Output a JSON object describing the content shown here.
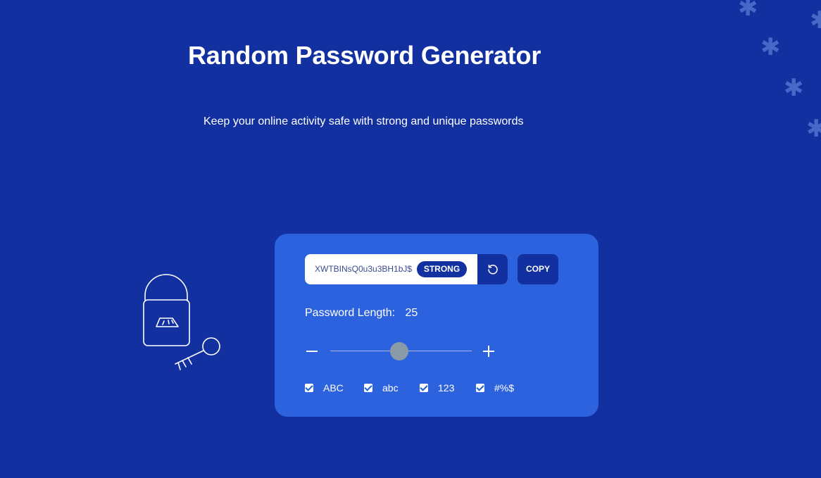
{
  "header": {
    "title": "Random Password Generator",
    "subtitle": "Keep your online activity safe with strong and unique passwords"
  },
  "generator": {
    "password": "XWTBINsQ0u3u3BH1bJ$",
    "strength": "STRONG",
    "copy_label": "COPY",
    "refresh_icon": "refresh-icon",
    "length_label": "Password Length:",
    "length_value": "25",
    "length_fraction": 0.49,
    "options": [
      {
        "label": "ABC",
        "checked": true
      },
      {
        "label": "abc",
        "checked": true
      },
      {
        "label": "123",
        "checked": true
      },
      {
        "label": "#%$",
        "checked": true
      }
    ]
  },
  "colors": {
    "background": "#12309f",
    "card": "#2d62de",
    "badge": "#12309f",
    "slider_thumb": "#8a9aa6"
  },
  "icons": {
    "illustration": "lock-and-key-icon",
    "decoration": "asterisk-icon",
    "minus": "minus-icon",
    "plus": "plus-icon"
  }
}
